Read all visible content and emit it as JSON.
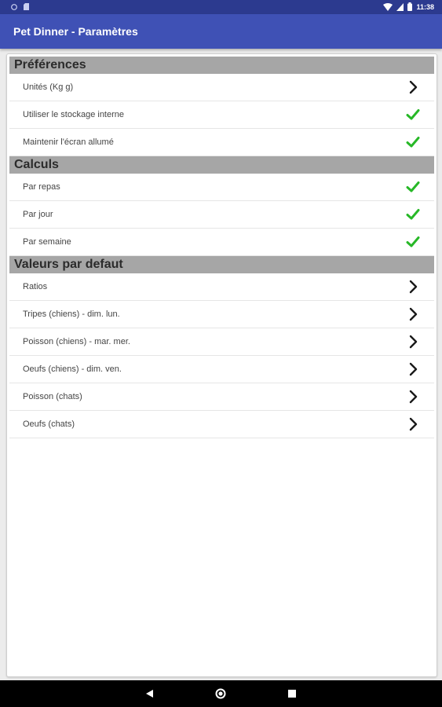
{
  "status_bar": {
    "time": "11:38",
    "icons": [
      "cast-icon",
      "sd-card-icon",
      "wifi-icon",
      "signal-icon",
      "battery-icon"
    ]
  },
  "app_bar": {
    "title": "Pet Dinner - Paramètres"
  },
  "sections": [
    {
      "title": "Préférences",
      "items": [
        {
          "label": "Unités (Kg g)",
          "indicator": "chevron"
        },
        {
          "label": "Utiliser le stockage interne",
          "indicator": "check"
        },
        {
          "label": "Maintenir l'écran allumé",
          "indicator": "check"
        }
      ]
    },
    {
      "title": "Calculs",
      "items": [
        {
          "label": "Par repas",
          "indicator": "check"
        },
        {
          "label": "Par jour",
          "indicator": "check"
        },
        {
          "label": "Par semaine",
          "indicator": "check"
        }
      ]
    },
    {
      "title": "Valeurs par defaut",
      "items": [
        {
          "label": "Ratios",
          "indicator": "chevron"
        },
        {
          "label": "Tripes (chiens) - dim. lun.",
          "indicator": "chevron"
        },
        {
          "label": "Poisson (chiens) - mar. mer.",
          "indicator": "chevron"
        },
        {
          "label": "Oeufs (chiens) - dim. ven.",
          "indicator": "chevron"
        },
        {
          "label": "Poisson (chats)",
          "indicator": "chevron"
        },
        {
          "label": "Oeufs (chats)",
          "indicator": "chevron"
        }
      ]
    }
  ],
  "nav_bar": {
    "buttons": [
      "back-icon",
      "home-icon",
      "recents-icon"
    ]
  },
  "colors": {
    "app_bar": "#3f51b5",
    "status_bar": "#2c3a8f",
    "section_header": "#a6a6a6",
    "check": "#27b827"
  }
}
